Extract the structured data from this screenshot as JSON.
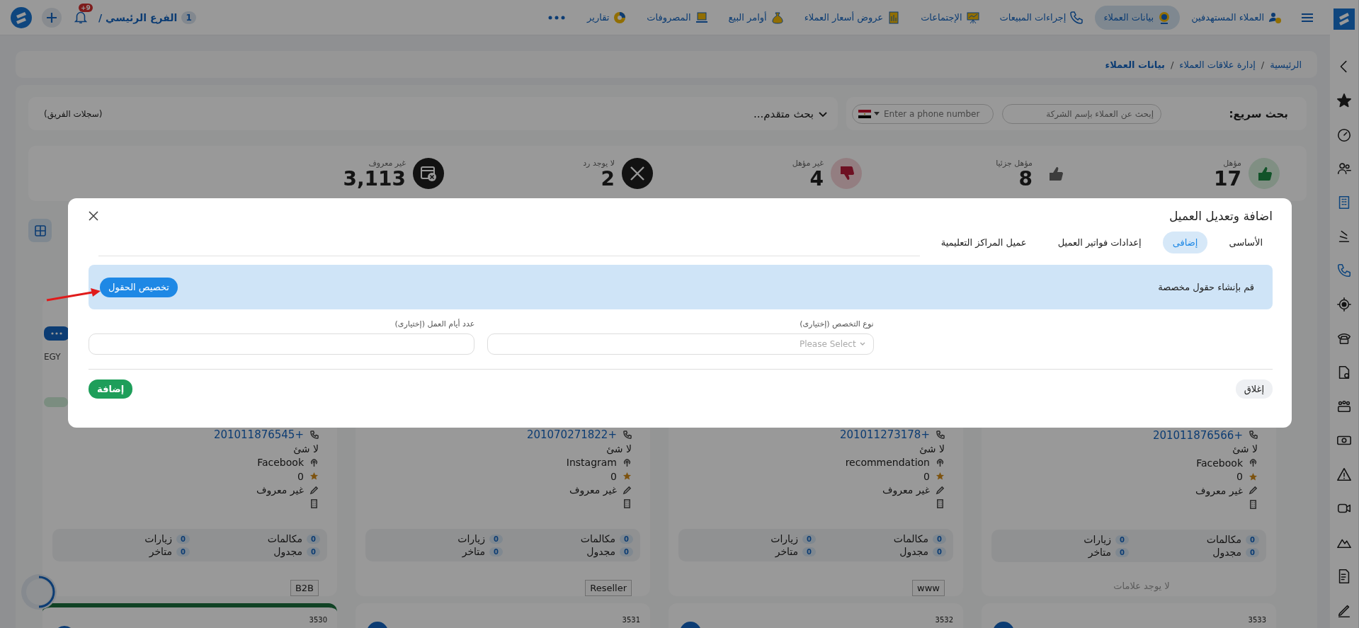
{
  "top_bar": {
    "nav_items": [
      {
        "label": "العملاء المستهدفين",
        "selected": false
      },
      {
        "label": "بيانات العملاء",
        "selected": true
      },
      {
        "label": "إجراءات المبيعات",
        "selected": false
      },
      {
        "label": "الإجتماعات",
        "selected": false
      },
      {
        "label": "عروض أسعار العملاء",
        "selected": false
      },
      {
        "label": "أوامر البيع",
        "selected": false
      },
      {
        "label": "المصروفات",
        "selected": false
      },
      {
        "label": "تقارير",
        "selected": false
      }
    ],
    "branch": {
      "count": "1",
      "name": "الفرع الرئيسي /"
    },
    "notification_badge": "+9"
  },
  "breadcrumb": {
    "items": [
      "الرئيسية",
      "إدارة علاقات العملاء",
      "بيانات العملاء"
    ],
    "separator": "/"
  },
  "search": {
    "label": "بحث سريع:",
    "company_placeholder": "إبحث عن العملاء بإسم الشركة",
    "phone_placeholder": "Enter a phone number",
    "advanced": "بحث متقدم...",
    "team_records": "(سجلات الفريق)"
  },
  "stats": [
    {
      "kind": "qualified",
      "label": "مؤهل",
      "value": "17"
    },
    {
      "kind": "partial",
      "label": "مؤهل جزئيا",
      "value": "8"
    },
    {
      "kind": "unqualified",
      "label": "غير مؤهل",
      "value": "4"
    },
    {
      "kind": "no_reply",
      "label": "لا يوجد رد",
      "value": "2"
    },
    {
      "kind": "unknown",
      "label": "غير معروف",
      "value": "3,113"
    }
  ],
  "cards": [
    {
      "phone": "+201011876566",
      "note": "لا شئ",
      "source": "Facebook",
      "rating": "0",
      "owner": "غير معروف",
      "counters": [
        {
          "label": "مكالمات",
          "count": "0"
        },
        {
          "label": "زيارات",
          "count": "0"
        },
        {
          "label": "مجدول",
          "count": "0"
        },
        {
          "label": "متاخر",
          "count": "0"
        }
      ],
      "no_tags": "لا يوجد علامات"
    },
    {
      "phone": "+201011273178",
      "note": "لا شئ",
      "source": "recommendation",
      "rating": "0",
      "owner": "غير معروف",
      "counters": [
        {
          "label": "مكالمات",
          "count": "0"
        },
        {
          "label": "زيارات",
          "count": "0"
        },
        {
          "label": "مجدول",
          "count": "0"
        },
        {
          "label": "متاخر",
          "count": "0"
        }
      ],
      "tags": [
        "www"
      ]
    },
    {
      "phone": "+201070271822",
      "note": "لا شئ",
      "source": "Instagram",
      "rating": "0",
      "owner": "غير معروف",
      "counters": [
        {
          "label": "مكالمات",
          "count": "0"
        },
        {
          "label": "زيارات",
          "count": "0"
        },
        {
          "label": "مجدول",
          "count": "0"
        },
        {
          "label": "متاخر",
          "count": "0"
        }
      ],
      "tags": [
        "Reseller"
      ]
    },
    {
      "country": "EGY",
      "phone": "+201011876545",
      "note": "لا شئ",
      "source": "Facebook",
      "rating": "0",
      "owner": "غير معروف",
      "counters": [
        {
          "label": "مكالمات",
          "count": "0"
        },
        {
          "label": "زيارات",
          "count": "0"
        },
        {
          "label": "مجدول",
          "count": "0"
        },
        {
          "label": "متاخر",
          "count": "0"
        }
      ],
      "tags": [
        "B2B"
      ]
    }
  ],
  "next_cards": [
    {
      "number": "3533",
      "highlighted": false
    },
    {
      "number": "3532",
      "highlighted": false
    },
    {
      "number": "3531",
      "highlighted": false
    },
    {
      "number": "3530",
      "highlighted": true
    }
  ],
  "modal": {
    "title": "اضافة وتعديل العميل",
    "tabs": [
      {
        "label": "الأساسى",
        "selected": false
      },
      {
        "label": "إضافى",
        "selected": true
      },
      {
        "label": "إعدادات فواتير العميل",
        "selected": false
      },
      {
        "label": "عميل المراكز التعليمية",
        "selected": false
      }
    ],
    "info_text": "قم بإنشاء حقول مخصصة",
    "customize_button": "تخصيص الحقول",
    "fields": [
      {
        "kind": "select",
        "label": "نوع التخصص (إختيارى)",
        "placeholder": "Please Select"
      },
      {
        "kind": "text",
        "label": "عدد أيام العمل (إختيارى)"
      }
    ],
    "close_button": "إغلاق",
    "add_button": "إضافة"
  }
}
